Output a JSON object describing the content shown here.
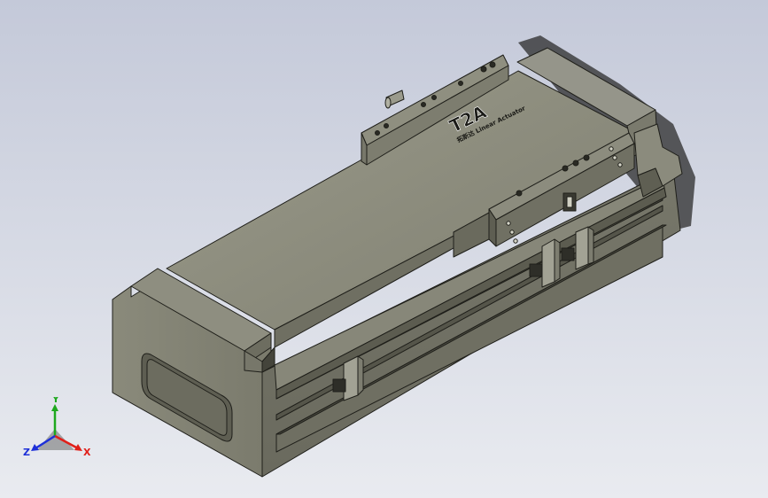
{
  "viewport": {
    "background_top": "#c4c9d9",
    "background_bottom": "#e9ebf0"
  },
  "model": {
    "logo_text": "T2A",
    "logo_subtext": "拓斯达 Linear Actuator",
    "body_color": "#7d7d6f",
    "top_color": "#8d8d7e",
    "dark_color": "#56564c",
    "edge_color": "#1f1f1a"
  },
  "triad": {
    "x_label": "X",
    "y_label": "Y",
    "z_label": "Z",
    "x_color": "#e0201a",
    "y_color": "#1ea81e",
    "z_color": "#1d2fd8"
  }
}
